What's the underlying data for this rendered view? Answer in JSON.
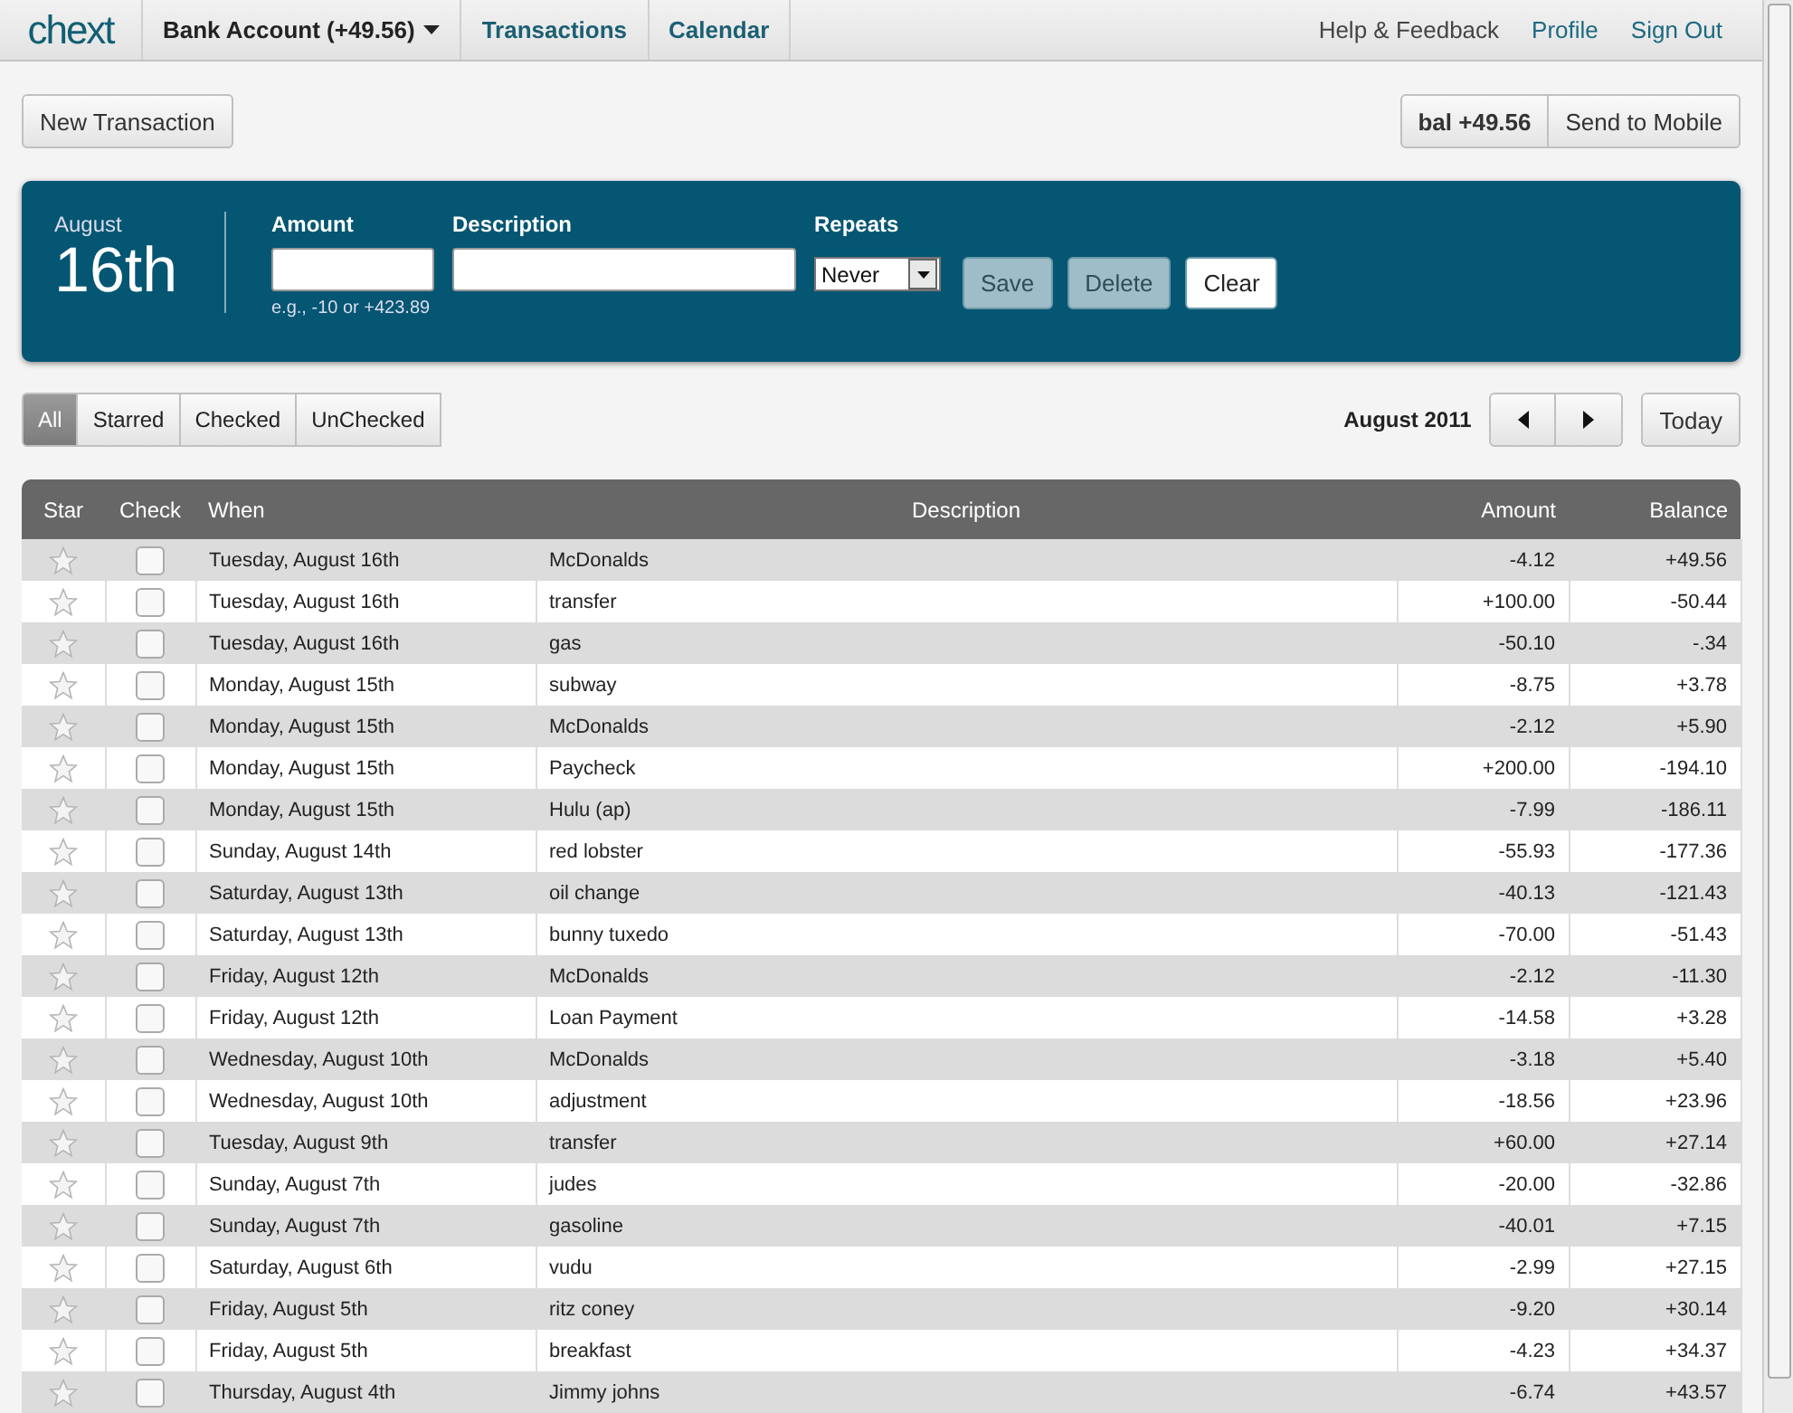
{
  "header": {
    "logo": "chext",
    "account": "Bank Account (+49.56)",
    "nav": [
      {
        "label": "Transactions"
      },
      {
        "label": "Calendar"
      }
    ],
    "links": [
      "Help & Feedback",
      "Profile",
      "Sign Out"
    ]
  },
  "toolbar": {
    "new_button": "New Transaction",
    "balance": "bal +49.56",
    "mobile_button": "Send to Mobile"
  },
  "form": {
    "month": "August",
    "day": "16th",
    "amount_label": "Amount",
    "amount_hint": "e.g., -10 or +423.89",
    "description_label": "Description",
    "repeats_label": "Repeats",
    "repeats_value": "Never",
    "buttons": [
      {
        "label": "Save",
        "disabled": true
      },
      {
        "label": "Delete",
        "disabled": true
      },
      {
        "label": "Clear",
        "disabled": false
      }
    ]
  },
  "filters": [
    {
      "label": "All",
      "selected": true
    },
    {
      "label": "Starred",
      "selected": false
    },
    {
      "label": "Checked",
      "selected": false
    },
    {
      "label": "UnChecked",
      "selected": false
    }
  ],
  "period": "August 2011",
  "today_button": "Today",
  "table": {
    "columns": [
      "Star",
      "Check",
      "When",
      "Description",
      "Amount",
      "Balance"
    ],
    "rows": [
      {
        "when": "Tuesday, August 16th",
        "description": "McDonalds",
        "amount": "-4.12",
        "balance": "+49.56",
        "starred": false,
        "checked": false
      },
      {
        "when": "Tuesday, August 16th",
        "description": "transfer",
        "amount": "+100.00",
        "balance": "-50.44",
        "starred": false,
        "checked": false
      },
      {
        "when": "Tuesday, August 16th",
        "description": "gas",
        "amount": "-50.10",
        "balance": "-.34",
        "starred": false,
        "checked": false
      },
      {
        "when": "Monday, August 15th",
        "description": "subway",
        "amount": "-8.75",
        "balance": "+3.78",
        "starred": false,
        "checked": false
      },
      {
        "when": "Monday, August 15th",
        "description": "McDonalds",
        "amount": "-2.12",
        "balance": "+5.90",
        "starred": false,
        "checked": false
      },
      {
        "when": "Monday, August 15th",
        "description": "Paycheck",
        "amount": "+200.00",
        "balance": "-194.10",
        "starred": false,
        "checked": false
      },
      {
        "when": "Monday, August 15th",
        "description": "Hulu (ap)",
        "amount": "-7.99",
        "balance": "-186.11",
        "starred": false,
        "checked": false
      },
      {
        "when": "Sunday, August 14th",
        "description": "red lobster",
        "amount": "-55.93",
        "balance": "-177.36",
        "starred": false,
        "checked": false
      },
      {
        "when": "Saturday, August 13th",
        "description": "oil change",
        "amount": "-40.13",
        "balance": "-121.43",
        "starred": false,
        "checked": false
      },
      {
        "when": "Saturday, August 13th",
        "description": "bunny tuxedo",
        "amount": "-70.00",
        "balance": "-51.43",
        "starred": false,
        "checked": false
      },
      {
        "when": "Friday, August 12th",
        "description": "McDonalds",
        "amount": "-2.12",
        "balance": "-11.30",
        "starred": false,
        "checked": false
      },
      {
        "when": "Friday, August 12th",
        "description": "Loan Payment",
        "amount": "-14.58",
        "balance": "+3.28",
        "starred": false,
        "checked": false
      },
      {
        "when": "Wednesday, August 10th",
        "description": "McDonalds",
        "amount": "-3.18",
        "balance": "+5.40",
        "starred": false,
        "checked": false
      },
      {
        "when": "Wednesday, August 10th",
        "description": "adjustment",
        "amount": "-18.56",
        "balance": "+23.96",
        "starred": false,
        "checked": false
      },
      {
        "when": "Tuesday, August 9th",
        "description": "transfer",
        "amount": "+60.00",
        "balance": "+27.14",
        "starred": false,
        "checked": false
      },
      {
        "when": "Sunday, August 7th",
        "description": "judes",
        "amount": "-20.00",
        "balance": "-32.86",
        "starred": false,
        "checked": false
      },
      {
        "when": "Sunday, August 7th",
        "description": "gasoline",
        "amount": "-40.01",
        "balance": "+7.15",
        "starred": false,
        "checked": false
      },
      {
        "when": "Saturday, August 6th",
        "description": "vudu",
        "amount": "-2.99",
        "balance": "+27.15",
        "starred": false,
        "checked": false
      },
      {
        "when": "Friday, August 5th",
        "description": "ritz coney",
        "amount": "-9.20",
        "balance": "+30.14",
        "starred": false,
        "checked": false
      },
      {
        "when": "Friday, August 5th",
        "description": "breakfast",
        "amount": "-4.23",
        "balance": "+34.37",
        "starred": false,
        "checked": false
      },
      {
        "when": "Thursday, August 4th",
        "description": "Jimmy johns",
        "amount": "-6.74",
        "balance": "+43.57",
        "starred": false,
        "checked": false
      }
    ]
  }
}
